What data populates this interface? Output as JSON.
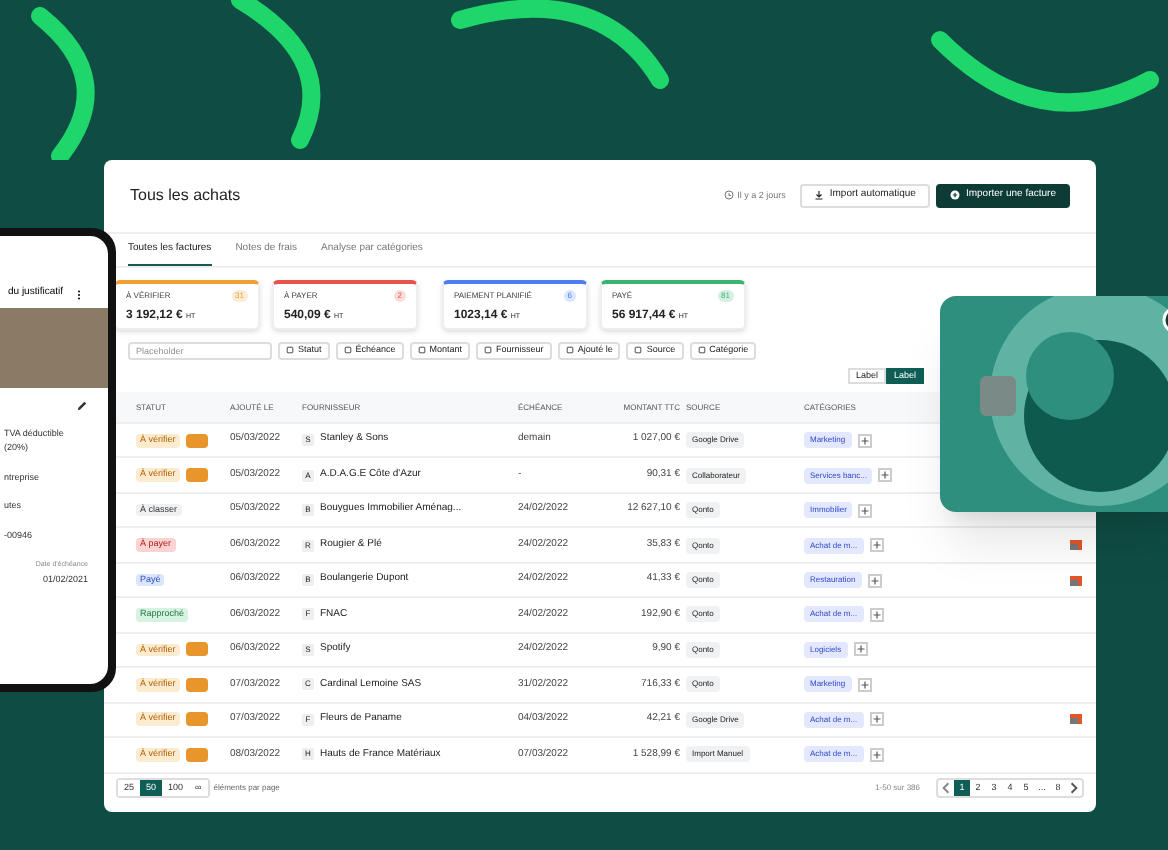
{
  "header": {
    "title": "Tous les achats",
    "sync_time": "Il y a 2 jours",
    "buttons": [
      {
        "label": "Import automatique",
        "kind": "secondary"
      },
      {
        "label": "Importer une facture",
        "kind": "primary"
      }
    ]
  },
  "tabs": [
    {
      "label": "Toutes les factures",
      "selected": true
    },
    {
      "label": "Notes de frais",
      "selected": false
    },
    {
      "label": "Analyse par catégories",
      "selected": false
    }
  ],
  "stats": [
    {
      "label": "À VÉRIFIER",
      "count": "31",
      "value": "3 192,12 €",
      "unit": "HT",
      "color": "#f0a030"
    },
    {
      "label": "À PAYER",
      "count": "2",
      "value": "540,09 €",
      "unit": "HT",
      "color": "#e5534b"
    },
    {
      "label": "PAIEMENT PLANIFIÉ",
      "count": "6",
      "value": "1023,14 €",
      "unit": "HT",
      "color": "#4c7ef0"
    },
    {
      "label": "PAYÉ",
      "count": "81",
      "value": "56 917,44 €",
      "unit": "HT",
      "color": "#3cb371"
    }
  ],
  "search": {
    "placeholder": "Placeholder"
  },
  "filters": [
    "Statut",
    "Échéance",
    "Montant",
    "Fournisseur",
    "Ajouté le",
    "Source",
    "Catégorie"
  ],
  "view_toggle": [
    {
      "label": "Label",
      "selected": false
    },
    {
      "label": "Label",
      "selected": true
    }
  ],
  "table": {
    "columns": [
      "STATUT",
      "AJOUTÉ LE",
      "FOURNISSEUR",
      "ÉCHÉANCE",
      "MONTANT TTC",
      "SOURCE",
      "CATÉGORIES"
    ],
    "rows": [
      {
        "status": "À vérifier",
        "kind": "verify",
        "added": "05/03/2022",
        "initial": "S",
        "supplier": "Stanley & Sons",
        "due": "demain",
        "amount": "1 027,00 €",
        "source": "Google Drive",
        "category": "Marketing",
        "flag": false
      },
      {
        "status": "À vérifier",
        "kind": "verify",
        "added": "05/03/2022",
        "initial": "A",
        "supplier": "A.D.A.G.E Côte d'Azur",
        "due": "-",
        "amount": "90,31 €",
        "source": "Collaborateur",
        "category": "Services banc...",
        "flag": false
      },
      {
        "status": "À classer",
        "kind": "classify",
        "added": "05/03/2022",
        "initial": "B",
        "supplier": "Bouygues Immobilier Aménag...",
        "due": "24/02/2022",
        "amount": "12 627,10 €",
        "source": "Qonto",
        "category": "Immobilier",
        "flag": false
      },
      {
        "status": "À payer",
        "kind": "topay",
        "added": "06/03/2022",
        "initial": "R",
        "supplier": "Rougier & Plé",
        "due": "24/02/2022",
        "amount": "35,83 €",
        "source": "Qonto",
        "category": "Achat de m...",
        "flag": true
      },
      {
        "status": "Payé",
        "kind": "paid",
        "added": "06/03/2022",
        "initial": "B",
        "supplier": "Boulangerie Dupont",
        "due": "24/02/2022",
        "amount": "41,33 €",
        "source": "Qonto",
        "category": "Restauration",
        "flag": true
      },
      {
        "status": "Rapproché",
        "kind": "matched",
        "added": "06/03/2022",
        "initial": "F",
        "supplier": "FNAC",
        "due": "24/02/2022",
        "amount": "192,90 €",
        "source": "Qonto",
        "category": "Achat de m...",
        "flag": false
      },
      {
        "status": "À vérifier",
        "kind": "verify",
        "added": "06/03/2022",
        "initial": "S",
        "supplier": "Spotify",
        "due": "24/02/2022",
        "amount": "9,90 €",
        "source": "Qonto",
        "category": "Logiciels",
        "flag": false
      },
      {
        "status": "À vérifier",
        "kind": "verify",
        "added": "07/03/2022",
        "initial": "C",
        "supplier": "Cardinal Lemoine SAS",
        "due": "31/02/2022",
        "amount": "716,33 €",
        "source": "Qonto",
        "category": "Marketing",
        "flag": false
      },
      {
        "status": "À vérifier",
        "kind": "verify",
        "added": "07/03/2022",
        "initial": "F",
        "supplier": "Fleurs de Paname",
        "due": "04/03/2022",
        "amount": "42,21 €",
        "source": "Google Drive",
        "category": "Achat de m...",
        "flag": true
      },
      {
        "status": "À vérifier",
        "kind": "verify",
        "added": "08/03/2022",
        "initial": "H",
        "supplier": "Hauts de France Matériaux",
        "due": "07/03/2022",
        "amount": "1 528,99 €",
        "source": "Import Manuel",
        "category": "Achat de m...",
        "flag": false
      }
    ]
  },
  "pagination": {
    "sizes": [
      {
        "label": "25",
        "selected": false
      },
      {
        "label": "50",
        "selected": true
      },
      {
        "label": "100",
        "selected": false
      },
      {
        "label": "∞",
        "selected": false
      }
    ],
    "per_page": "éléments par page",
    "range": "1-50 sur 386",
    "pages": [
      {
        "label": "1",
        "selected": true
      },
      {
        "label": "2",
        "selected": false
      },
      {
        "label": "3",
        "selected": false
      },
      {
        "label": "4",
        "selected": false
      },
      {
        "label": "5",
        "selected": false
      },
      {
        "label": "...",
        "selected": false
      },
      {
        "label": "8",
        "selected": false
      }
    ]
  },
  "phone": {
    "title": "du justificatif",
    "vat": "TVA déductible (20%)",
    "line_1": "ntreprise",
    "line_2": "utes",
    "reference": "-00946",
    "due_label": "Date d'échéance",
    "due_date": "01/02/2021"
  }
}
